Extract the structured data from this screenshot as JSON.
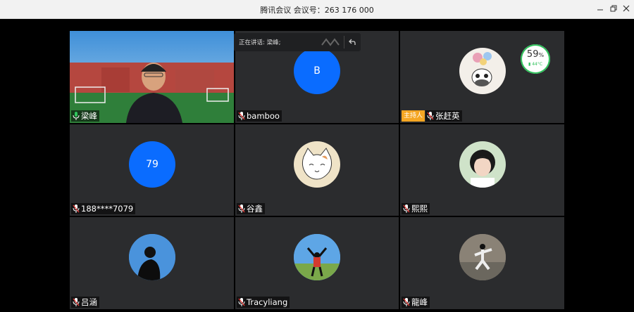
{
  "window": {
    "title": "腾讯会议  会议号：263 176 000",
    "minimize_icon": "minimize-icon",
    "maximize_icon": "restore-icon",
    "close_icon": "close-icon"
  },
  "speaking": {
    "label": "正在讲话: 梁峰;"
  },
  "cpu": {
    "percent": "59",
    "unit": "%",
    "temp": "44°C"
  },
  "participants": [
    {
      "name": "梁峰",
      "mic": "mic-on",
      "type": "video"
    },
    {
      "name": "bamboo",
      "mic": "mic-muted",
      "avatar_text": "B"
    },
    {
      "name": "张赶英",
      "mic": "mic-muted",
      "host_badge": "主持人"
    },
    {
      "name": "188****7079",
      "mic": "mic-muted",
      "avatar_text": "79"
    },
    {
      "name": "谷鑫",
      "mic": "mic-muted"
    },
    {
      "name": "熙熙",
      "mic": "mic-muted"
    },
    {
      "name": "吕涵",
      "mic": "mic-muted"
    },
    {
      "name": "Tracyliang",
      "mic": "mic-muted"
    },
    {
      "name": "龍峰",
      "mic": "mic-muted"
    }
  ],
  "colors": {
    "accent_blue": "#0a6cff",
    "host_badge": "#f5a623",
    "mic_on": "#2fc25b",
    "tile_bg": "#2b2c2e"
  }
}
